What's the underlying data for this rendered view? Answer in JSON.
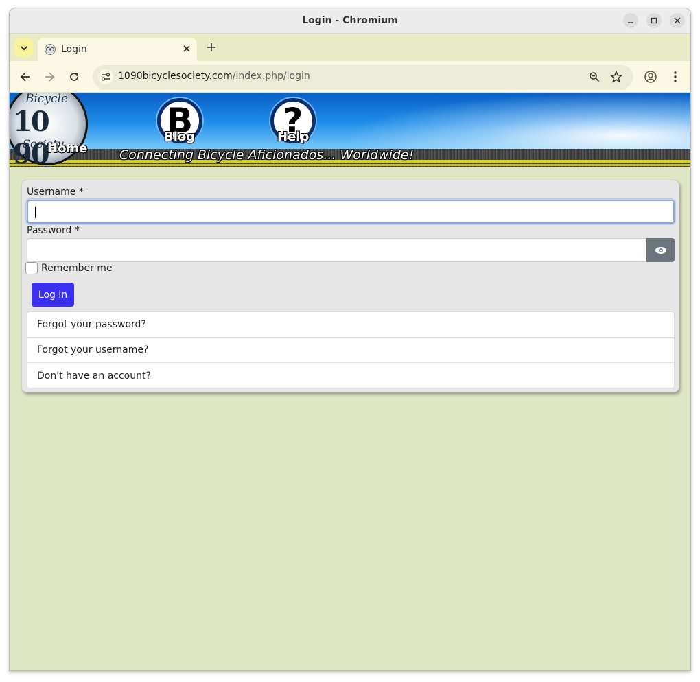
{
  "window": {
    "title": "Login - Chromium"
  },
  "tabs": [
    {
      "title": "Login"
    }
  ],
  "toolbar": {
    "url_host": "1090bicyclesociety.com",
    "url_path": "/index.php/login"
  },
  "banner": {
    "logo_top": "Bicycle",
    "logo_number": "10 90",
    "logo_bottom": "Society",
    "nav": [
      {
        "label": "Home"
      },
      {
        "label": "Blog",
        "glyph": "B"
      },
      {
        "label": "Help",
        "glyph": "?"
      }
    ],
    "tagline": "Connecting Bicycle Aficionados... Worldwide!"
  },
  "login": {
    "username_label": "Username *",
    "username_value": "",
    "password_label": "Password *",
    "password_value": "",
    "remember_label": "Remember me",
    "remember_checked": false,
    "submit_label": "Log in",
    "links": [
      {
        "label": "Forgot your password?"
      },
      {
        "label": "Forgot your username?"
      },
      {
        "label": "Don't have an account?"
      }
    ]
  },
  "colors": {
    "page_bg": "#dfe6c4",
    "button_primary": "#3b2ff0",
    "eye_button": "#6c757d",
    "tab_strip": "#e9ebc6"
  },
  "icons": [
    "tab-search-icon",
    "favicon-icon",
    "close-icon",
    "new-tab-icon",
    "back-icon",
    "forward-icon",
    "reload-icon",
    "site-info-icon",
    "zoom-icon",
    "bookmark-star-icon",
    "profile-icon",
    "menu-icon",
    "minimize-icon",
    "maximize-icon",
    "window-close-icon",
    "eye-icon"
  ]
}
